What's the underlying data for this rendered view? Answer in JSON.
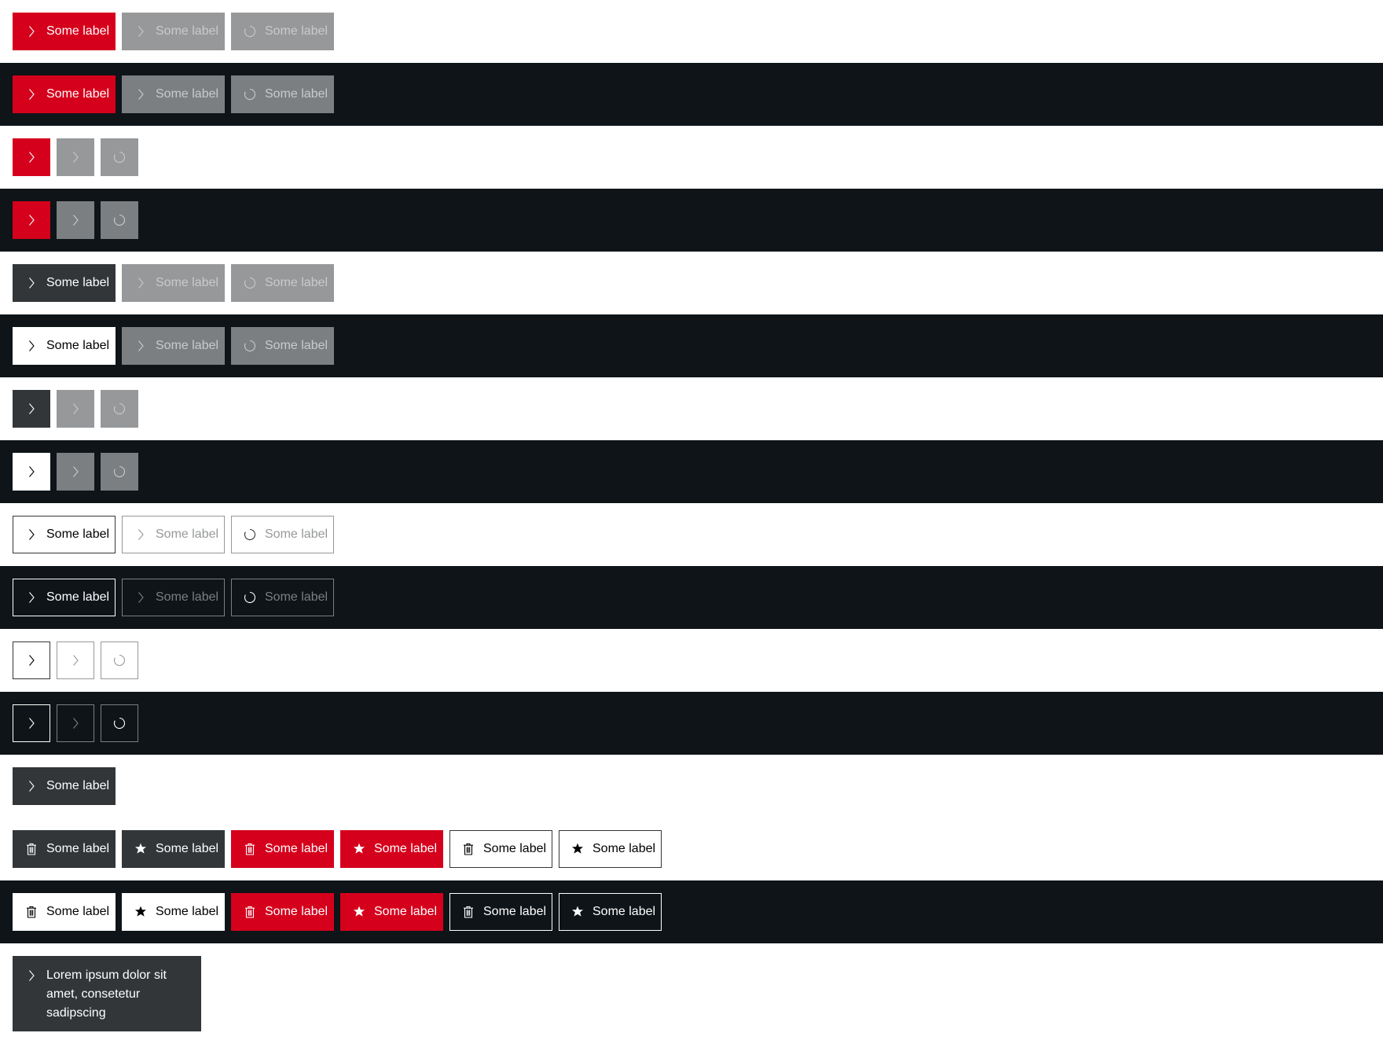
{
  "label": "Some label",
  "long_label": "Lorem ipsum dolor sit amet, consetetur sadipscing",
  "icons": {
    "arrow": "arrow-head-right-icon",
    "spinner": "loading-spinner-icon",
    "delete": "delete-icon",
    "highlight": "highlight-icon"
  },
  "colors": {
    "primary": "#d5001c",
    "secondary": "#323639",
    "dark_background": "#0e1418",
    "disabled_light": "#96989a",
    "disabled_dark": "#7c7f81"
  }
}
